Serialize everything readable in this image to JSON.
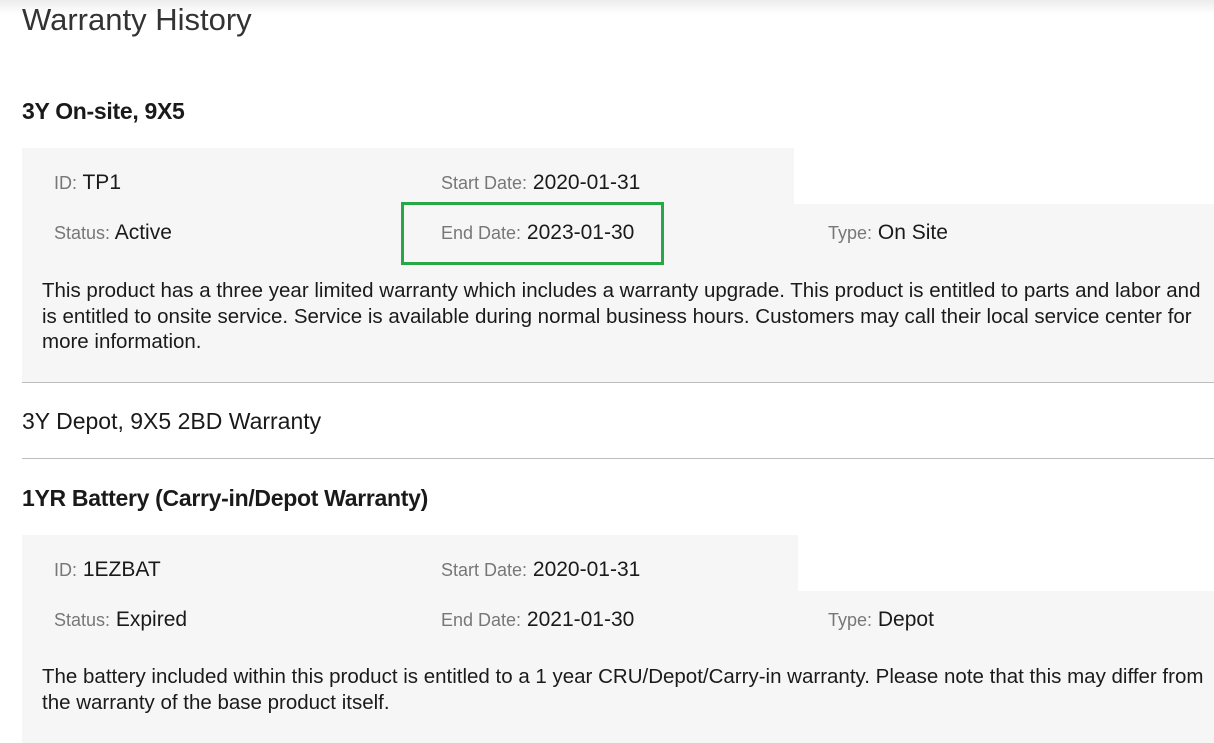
{
  "page": {
    "title": "Warranty History"
  },
  "labels": {
    "id": "ID:",
    "status": "Status:",
    "start_date": "Start Date:",
    "end_date": "End Date:",
    "type": "Type:"
  },
  "warranties": [
    {
      "name": "3Y On-site, 9X5",
      "id": "TP1",
      "status": "Active",
      "start_date": "2020-01-31",
      "end_date": "2023-01-30",
      "type": "On Site",
      "description": "This product has a three year limited warranty which includes a warranty upgrade. This product is entitled to parts and labor and is entitled to onsite service. Service is available during normal business hours. Customers may call their local service center for more information."
    },
    {
      "name": "3Y Depot, 9X5 2BD Warranty"
    },
    {
      "name": "1YR Battery (Carry-in/Depot Warranty)",
      "id": "1EZBAT",
      "status": "Expired",
      "start_date": "2020-01-31",
      "end_date": "2021-01-30",
      "type": "Depot",
      "description": "The battery included within this product is entitled to a 1 year CRU/Depot/Carry-in warranty. Please note that this may differ from the warranty of the base product itself."
    }
  ],
  "highlight_color": "#27a745"
}
